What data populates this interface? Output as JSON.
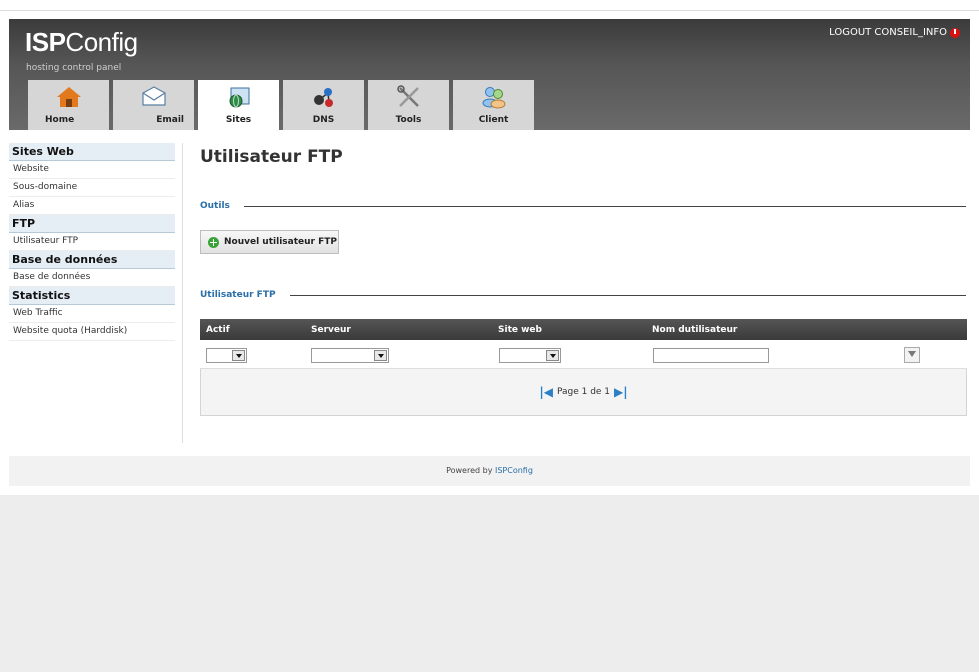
{
  "header": {
    "logo_prefix": "ISP",
    "logo_suffix": "Config",
    "tagline": "hosting control panel",
    "logout_label": "LOGOUT CONSEIL_INFO"
  },
  "tabs": [
    {
      "label": "Home",
      "icon": "home-icon"
    },
    {
      "label": "Email",
      "icon": "envelope-icon"
    },
    {
      "label": "Sites",
      "icon": "globe-sites-icon",
      "active": true
    },
    {
      "label": "DNS",
      "icon": "dns-icon"
    },
    {
      "label": "Tools",
      "icon": "tools-icon"
    },
    {
      "label": "Client",
      "icon": "client-icon"
    }
  ],
  "sidebar": {
    "sections": [
      {
        "title": "Sites Web",
        "items": [
          "Website",
          "Sous-domaine",
          "Alias"
        ]
      },
      {
        "title": "FTP",
        "items": [
          "Utilisateur FTP"
        ]
      },
      {
        "title": "Base de données",
        "items": [
          "Base de données"
        ]
      },
      {
        "title": "Statistics",
        "items": [
          "Web Traffic",
          "Website quota (Harddisk)"
        ]
      }
    ]
  },
  "main": {
    "title": "Utilisateur FTP",
    "tools_label": "Outils",
    "new_button_label": "Nouvel utilisateur FTP",
    "list_label": "Utilisateur FTP",
    "columns": [
      "Actif",
      "Serveur",
      "Site web",
      "Nom dutilisateur"
    ],
    "pager_text": "Page 1 de 1"
  },
  "footer": {
    "prefix": "Powered by ",
    "link": "ISPConfig"
  }
}
